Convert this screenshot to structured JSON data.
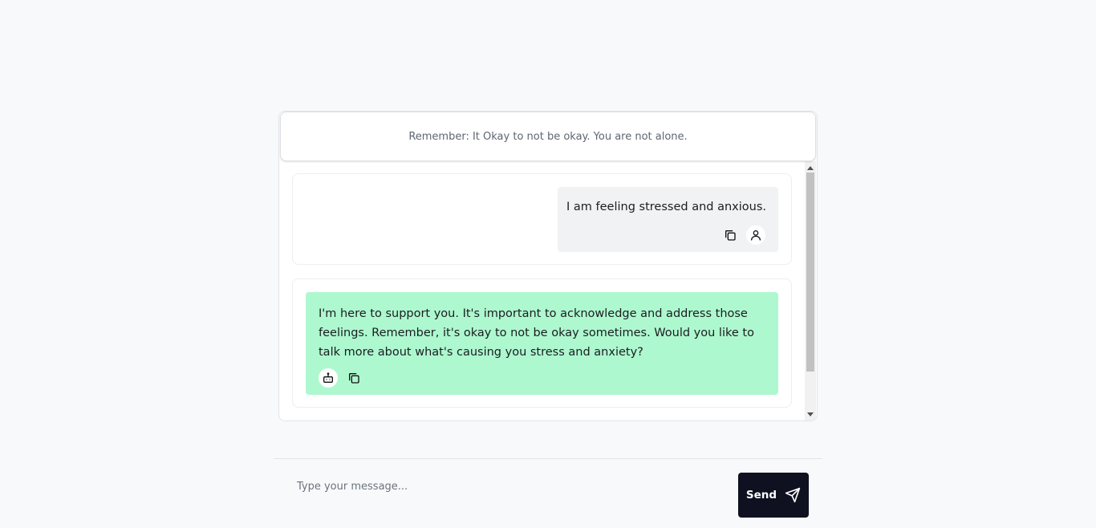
{
  "banner": {
    "text": "Remember: It Okay to not be okay. You are not alone."
  },
  "messages": [
    {
      "role": "user",
      "text": "I am feeling stressed and anxious.",
      "icons": [
        "copy-icon",
        "user-icon"
      ]
    },
    {
      "role": "bot",
      "text": "I'm here to support you. It's important to acknowledge and address those feelings. Remember, it's okay to not be okay sometimes. Would you like to talk more about what's causing you stress and anxiety?",
      "icons": [
        "bot-icon",
        "copy-icon"
      ]
    }
  ],
  "composer": {
    "placeholder": "Type your message...",
    "value": "",
    "send_label": "Send",
    "send_icon": "send-icon"
  },
  "colors": {
    "bot_bubble": "#aef8cf",
    "user_bubble": "#f1f2f4",
    "send_button": "#0f1020",
    "page_background": "#f8f9fb"
  }
}
